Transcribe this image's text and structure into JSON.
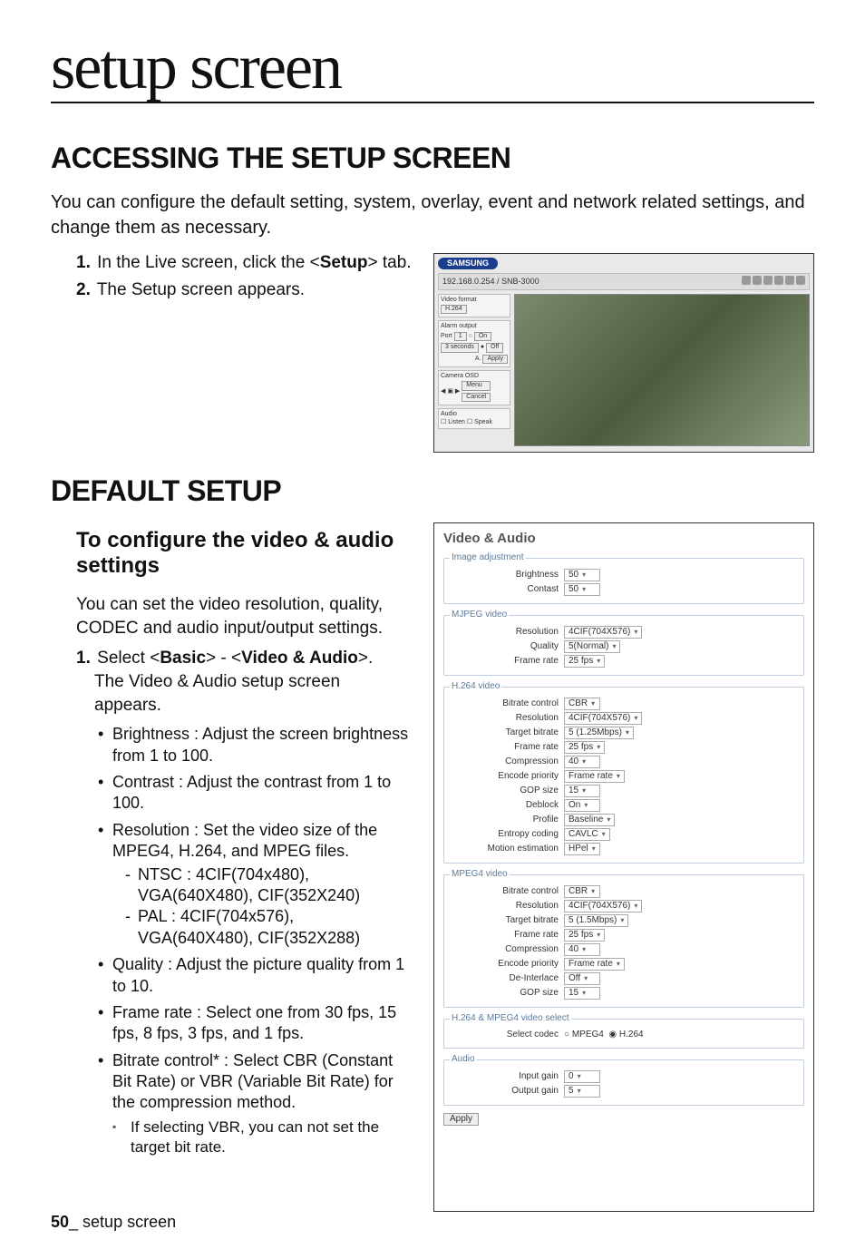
{
  "chapter_title": "setup screen",
  "section_accessing": {
    "heading": "ACCESSING THE SETUP SCREEN",
    "lead": "You can configure the default setting, system, overlay, event and network related settings, and change them as necessary.",
    "steps": [
      {
        "n": "1.",
        "text_pre": "In the Live screen, click the <",
        "bold": "Setup",
        "text_post": "> tab."
      },
      {
        "n": "2.",
        "text_pre": "The Setup screen appears.",
        "bold": "",
        "text_post": ""
      }
    ]
  },
  "live_shot": {
    "brand": "SAMSUNG",
    "ip": "192.168.0.254 / SNB-3000",
    "panels": {
      "video_format": "Video format",
      "h264": "H.264",
      "alarm_output": "Alarm output",
      "port": "Port",
      "port_val": "1",
      "on": "On",
      "off": "Off",
      "duration": "3 seconds",
      "apply": "Apply",
      "camera_osd": "Camera OSD",
      "menu": "Menu",
      "cancel": "Cancel",
      "audio": "Audio",
      "listen": "Listen",
      "speak": "Speak"
    }
  },
  "section_default": {
    "heading": "DEFAULT SETUP",
    "sub_heading": "To configure the video & audio settings",
    "intro": "You can set the video resolution, quality, CODEC and audio input/output settings.",
    "step1_pre": "Select <",
    "step1_b1": "Basic",
    "step1_mid": "> - <",
    "step1_b2": "Video & Audio",
    "step1_post": ">.",
    "step1_line2": "The Video & Audio setup screen appears.",
    "bullets": [
      "Brightness : Adjust the screen brightness from 1 to 100.",
      "Contrast : Adjust the contrast from 1 to 100.",
      "Resolution : Set the video size of the MPEG4, H.264, and MPEG files.",
      "Quality : Adjust the picture quality from 1 to 10.",
      "Frame rate : Select one from 30 fps, 15 fps, 8 fps, 3 fps, and 1 fps.",
      "Bitrate control* : Select CBR (Constant Bit Rate) or VBR (Variable Bit Rate) for the compression method."
    ],
    "resolution_sub": [
      "NTSC : 4CIF(704x480), VGA(640X480), CIF(352X240)",
      "PAL : 4CIF(704x576), VGA(640X480), CIF(352X288)"
    ],
    "note": "If selecting VBR, you can not set the target bit rate."
  },
  "form_shot": {
    "title": "Video & Audio",
    "groups": {
      "image_adjustment": {
        "legend": "Image adjustment",
        "rows": [
          {
            "label": "Brightness",
            "value": "50"
          },
          {
            "label": "Contast",
            "value": "50"
          }
        ]
      },
      "mjpeg": {
        "legend": "MJPEG video",
        "rows": [
          {
            "label": "Resolution",
            "value": "4CIF(704X576)"
          },
          {
            "label": "Quality",
            "value": "5(Normal)"
          },
          {
            "label": "Frame rate",
            "value": "25 fps"
          }
        ]
      },
      "h264": {
        "legend": "H.264 video",
        "rows": [
          {
            "label": "Bitrate control",
            "value": "CBR"
          },
          {
            "label": "Resolution",
            "value": "4CIF(704X576)"
          },
          {
            "label": "Target bitrate",
            "value": "5 (1.25Mbps)"
          },
          {
            "label": "Frame rate",
            "value": "25 fps"
          },
          {
            "label": "Compression",
            "value": "40"
          },
          {
            "label": "Encode priority",
            "value": "Frame rate"
          },
          {
            "label": "GOP size",
            "value": "15"
          },
          {
            "label": "Deblock",
            "value": "On"
          },
          {
            "label": "Profile",
            "value": "Baseline"
          },
          {
            "label": "Entropy coding",
            "value": "CAVLC"
          },
          {
            "label": "Motion estimation",
            "value": "HPel"
          }
        ]
      },
      "mpeg4": {
        "legend": "MPEG4 video",
        "rows": [
          {
            "label": "Bitrate control",
            "value": "CBR"
          },
          {
            "label": "Resolution",
            "value": "4CIF(704X576)"
          },
          {
            "label": "Target bitrate",
            "value": "5 (1.5Mbps)"
          },
          {
            "label": "Frame rate",
            "value": "25 fps"
          },
          {
            "label": "Compression",
            "value": "40"
          },
          {
            "label": "Encode priority",
            "value": "Frame rate"
          },
          {
            "label": "De-Interlace",
            "value": "Off"
          },
          {
            "label": "GOP size",
            "value": "15"
          }
        ]
      },
      "codec_select": {
        "legend": "H.264 & MPEG4 video select",
        "label": "Select codec",
        "opt1": "MPEG4",
        "opt2": "H.264"
      },
      "audio": {
        "legend": "Audio",
        "rows": [
          {
            "label": "Input gain",
            "value": "0"
          },
          {
            "label": "Output gain",
            "value": "5"
          }
        ]
      }
    },
    "apply": "Apply"
  },
  "footer": {
    "page": "50",
    "underscore": "_",
    "label": " setup screen"
  }
}
